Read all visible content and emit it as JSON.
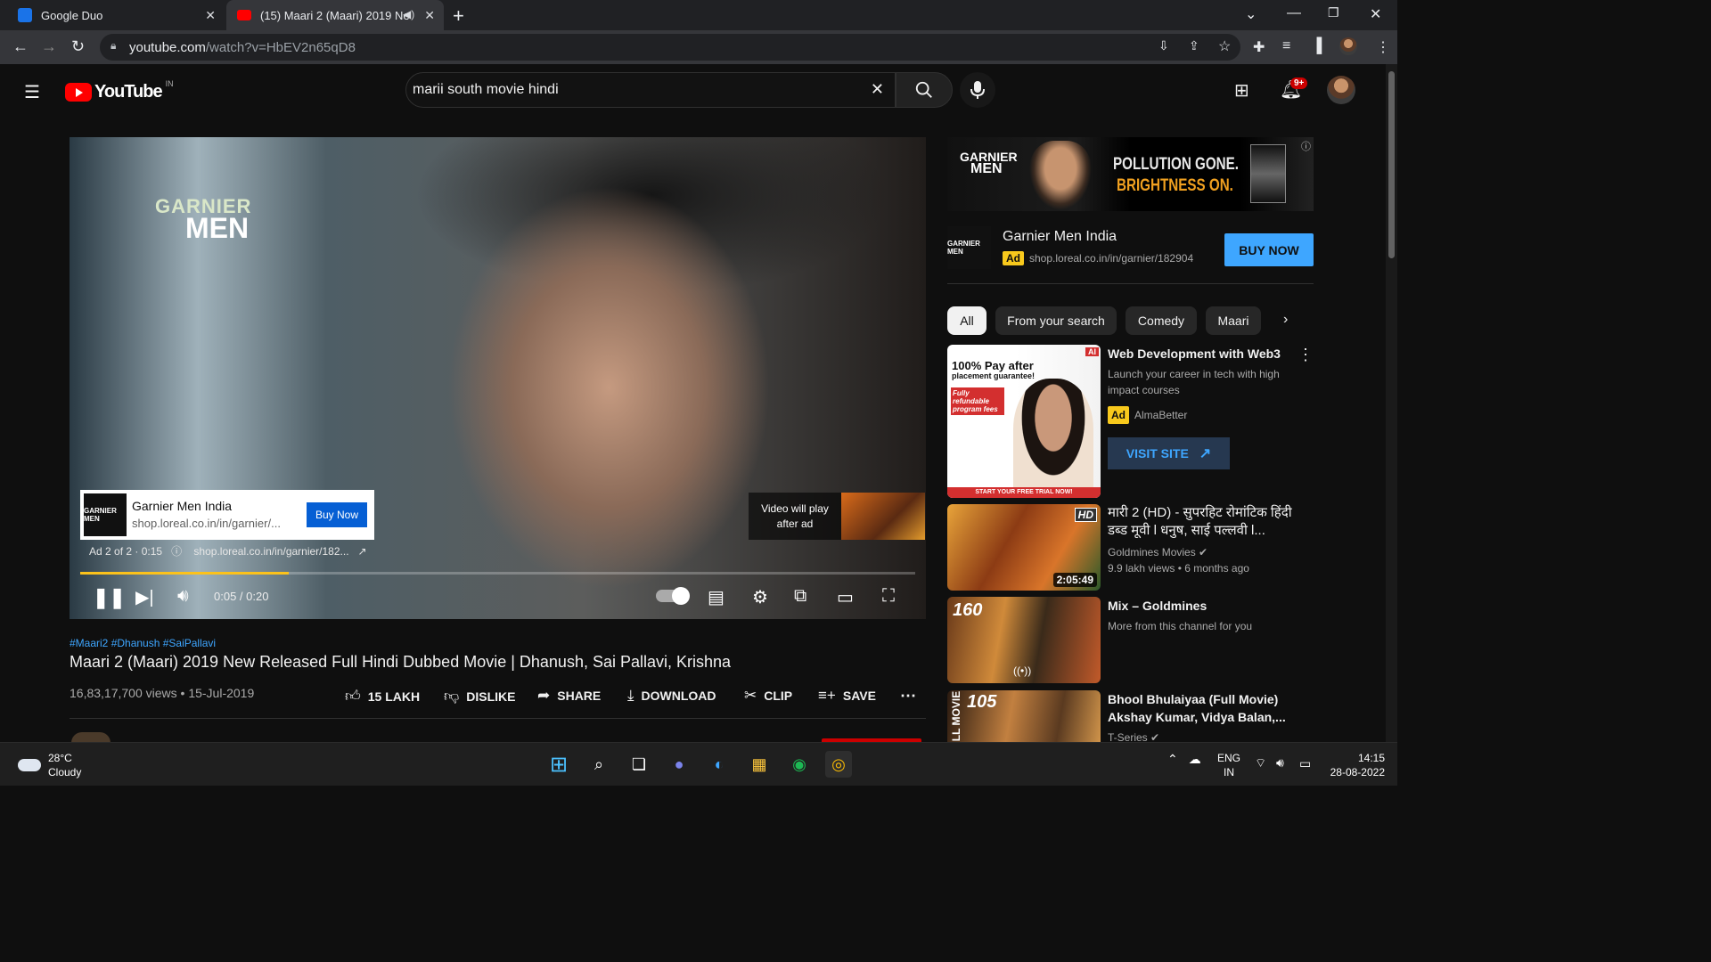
{
  "browser": {
    "tabs": [
      {
        "title": "Google Duo",
        "favicon_color": "#1a73e8"
      },
      {
        "title": "(15) Maari 2 (Maari) 2019 Ne",
        "favicon_color": "#ff0000",
        "active": true
      }
    ],
    "url_host": "youtube.com",
    "url_path": "/watch?v=HbEV2n65qD8"
  },
  "youtube": {
    "logo_text": "YouTube",
    "country_code": "IN",
    "search_query": "marii south movie hindi",
    "notification_count": "9+"
  },
  "player": {
    "ad_brand_logo_top": "GARNIER",
    "ad_brand_logo_bottom": "MEN",
    "ad_card": {
      "logo_text": "GARNIER MEN",
      "name": "Garnier Men India",
      "link": "shop.loreal.co.in/in/garnier/...",
      "button": "Buy Now"
    },
    "ad_info": {
      "counter": "Ad 2 of 2 · 0:15",
      "link": "shop.loreal.co.in/in/garnier/182..."
    },
    "up_next_text": "Video will play after ad",
    "time": "0:05 / 0:20",
    "progress": 0.25
  },
  "video": {
    "hashtags": "#Maari2 #Dhanush #SaiPallavi",
    "title": "Maari 2 (Maari) 2019 New Released Full Hindi Dubbed Movie | Dhanush, Sai Pallavi, Krishna",
    "views_date": "16,83,17,700 views • 15-Jul-2019",
    "actions": {
      "like": "15 LAKH",
      "dislike": "DISLIKE",
      "share": "SHARE",
      "download": "DOWNLOAD",
      "clip": "CLIP",
      "save": "SAVE"
    }
  },
  "sidebar": {
    "banner": {
      "logo_top": "GARNIER",
      "logo_bottom": "MEN",
      "line1": "POLLUTION GONE.",
      "line2": "BRIGHTNESS ON."
    },
    "ad_channel": {
      "logo_text": "GARNIER MEN",
      "name": "Garnier Men India",
      "ad_label": "Ad",
      "link": "shop.loreal.co.in/in/garnier/182904",
      "button": "BUY NOW"
    },
    "chips": [
      "All",
      "From your search",
      "Comedy",
      "Maari"
    ],
    "recommendations": [
      {
        "title": "Web Development with Web3",
        "desc": "Launch your career in tech with high impact courses",
        "ad_label": "Ad",
        "advertiser": "AlmaBetter",
        "button": "VISIT SITE",
        "thumb_headline": "100% Pay after",
        "thumb_sub": "placement guarantee!",
        "thumb_badge": "AI",
        "thumb_note": "Fully refundable program fees",
        "thumb_footer": "START YOUR FREE TRIAL NOW!"
      },
      {
        "title": "मारी 2 (HD) - सुपरहिट रोमांटिक हिंदी डब्ड मूवी l धनुष, साई पल्लवी l...",
        "channel": "Goldmines Movies",
        "meta": "9.9 lakh views • 6 months ago",
        "duration": "2:05:49",
        "thumb_badge": "HD"
      },
      {
        "title": "Mix – Goldmines",
        "desc": "More from this channel for you",
        "thumb_badge": "160"
      },
      {
        "title": "Bhool Bhulaiyaa (Full Movie) Akshay Kumar, Vidya Balan,...",
        "channel": "T-Series",
        "thumb_badge": "105",
        "thumb_side": "LL MOVIE"
      }
    ]
  },
  "taskbar": {
    "temperature": "28°C",
    "condition": "Cloudy",
    "lang_line1": "ENG",
    "lang_line2": "IN",
    "time": "14:15",
    "date": "28-08-2022"
  },
  "colors": {
    "youtube_red": "#ff0000",
    "link_blue": "#3ea6ff",
    "ad_yellow": "#f8c91c",
    "progress_yellow": "#fcc21b"
  }
}
